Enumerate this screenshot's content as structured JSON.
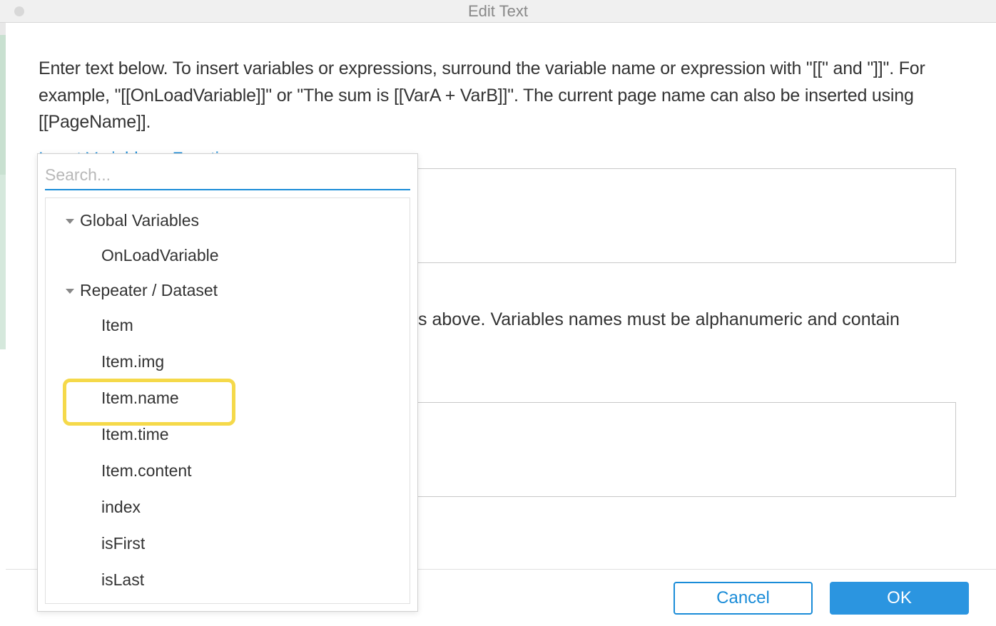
{
  "window": {
    "title": "Edit Text"
  },
  "instruction": "Enter text below. To insert variables or expressions, surround the variable name or expression with \"[[\" and \"]]\". For example, \"[[OnLoadVariable]]\" or \"The sum is [[VarA + VarB]]\". The current page name can also be inserted using [[PageName]].",
  "insert_link_label": "Insert Variable or Function...",
  "continuation_text": "s above. Variables names must be alphanumeric and contain",
  "search": {
    "placeholder": "Search..."
  },
  "tree": {
    "groups": [
      {
        "label": "Global Variables",
        "items": [
          "OnLoadVariable"
        ]
      },
      {
        "label": "Repeater / Dataset",
        "items": [
          "Item",
          "Item.img",
          "Item.name",
          "Item.time",
          "Item.content",
          "index",
          "isFirst",
          "isLast"
        ],
        "highlighted_index": 2
      }
    ]
  },
  "buttons": {
    "cancel": "Cancel",
    "ok": "OK"
  }
}
